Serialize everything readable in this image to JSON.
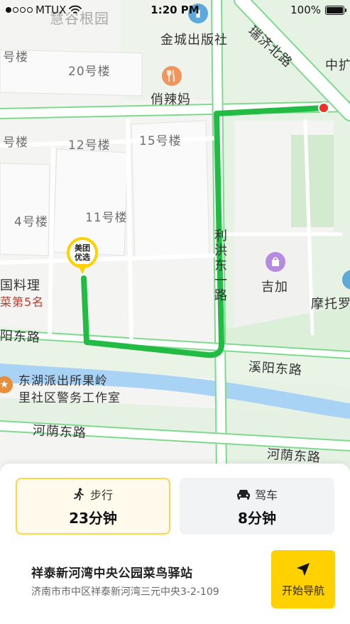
{
  "status_bar": {
    "carrier": "MTUX",
    "time": "1:20 PM",
    "battery": "100%",
    "signal_bars_filled": 1,
    "signal_bars_total": 5
  },
  "map": {
    "labels": {
      "huigu_garden": "慧谷根园",
      "publisher": "金城出版社",
      "bldg_top_left": "号楼",
      "bldg_20": "20号楼",
      "restaurant": "俏辣妈",
      "bldg_mid_left": "号楼",
      "bldg_12": "12号楼",
      "bldg_15": "15号楼",
      "bldg_4": "4号楼",
      "bldg_11": "11号楼",
      "cuisine": "国料理",
      "cuisine_rank": "菜第5名",
      "jijia": "吉加",
      "motuo": "摩托罗",
      "top_right": "中扩",
      "diag_road": "瑞济北路",
      "lishan_road": "利洪东一路",
      "yangdong_road": "阳东路",
      "xiyang_road": "溪阳东路",
      "police_line1": "东湖派出所果岭",
      "police_line2": "里社区警务工作室",
      "heyin_road_left": "河荫东路",
      "heyin_road_right": "河荫东路"
    },
    "marker": {
      "line1": "美团",
      "line2": "优选"
    },
    "colors": {
      "route": "#22bb44",
      "destination": "#e8322b",
      "river": "#a9d3f5",
      "green": "#d6ecd6",
      "road_edge": "#7fd98e"
    }
  },
  "modes": {
    "walk": {
      "label": "步行",
      "duration": "23分钟",
      "icon": "walking-person-icon",
      "selected": true
    },
    "drive": {
      "label": "驾车",
      "duration": "8分钟",
      "icon": "car-icon",
      "selected": false
    }
  },
  "destination": {
    "name": "祥泰新河湾中央公园菜鸟驿站",
    "address": "济南市市中区祥泰新河湾三元中央3-2-109"
  },
  "navigate_button": {
    "label": "开始导航",
    "icon": "navigation-arrow-icon"
  }
}
